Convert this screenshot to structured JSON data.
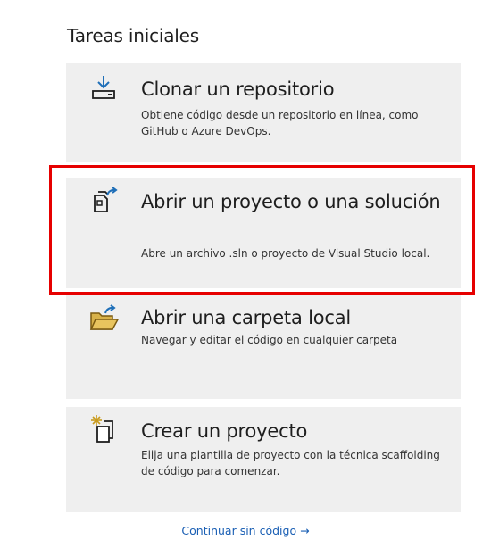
{
  "section_title": "Tareas iniciales",
  "cards": [
    {
      "id": "clone",
      "icon": "download-icon",
      "title": "Clonar un repositorio",
      "description": "Obtiene código desde un repositorio en línea, como GitHub o Azure DevOps."
    },
    {
      "id": "open",
      "icon": "open-project-icon",
      "title": "Abrir un proyecto o una solución",
      "description": "Abre un archivo .sln o proyecto de Visual Studio local."
    },
    {
      "id": "folder",
      "icon": "open-folder-icon",
      "title": "Abrir una carpeta local",
      "description": "Navegar y editar el código en cualquier carpeta"
    },
    {
      "id": "create",
      "icon": "new-project-icon",
      "title": "Crear un proyecto",
      "description": "Elija una plantilla de proyecto con la técnica scaffolding de código para comenzar."
    }
  ],
  "continue_link": {
    "label": "Continuar sin código",
    "arrow": "→"
  },
  "colors": {
    "card_background": "#efefef",
    "highlight_border": "#e60000",
    "link": "#1a5fb4",
    "folder_icon": "#c9a227"
  }
}
